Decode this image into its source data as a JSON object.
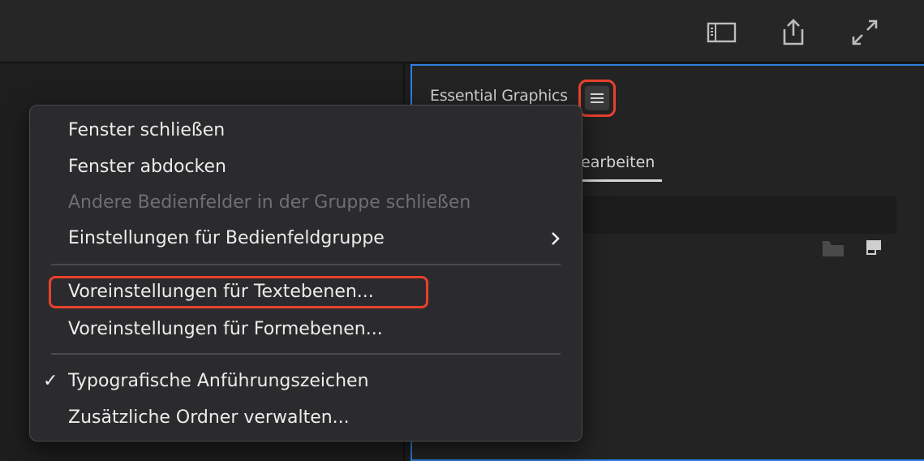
{
  "toolbar": {
    "icons": [
      "panel-layout-icon",
      "share-export-icon",
      "fullscreen-expand-icon"
    ]
  },
  "panel": {
    "title": "Essential Graphics",
    "menu_icon": "hamburger-menu-icon",
    "tab_label": "earbeiten",
    "icons": [
      "folder-icon",
      "new-layer-icon"
    ]
  },
  "context_menu": {
    "items": [
      {
        "label": "Fenster schließen",
        "enabled": true
      },
      {
        "label": "Fenster abdocken",
        "enabled": true
      },
      {
        "label": "Andere Bedienfelder in der Gruppe schließen",
        "enabled": false
      },
      {
        "label": "Einstellungen für Bedienfeldgruppe",
        "enabled": true,
        "submenu": true
      },
      {
        "label": "Voreinstellungen für Textebenen...",
        "enabled": true,
        "highlighted": true
      },
      {
        "label": "Voreinstellungen für Formebenen...",
        "enabled": true
      },
      {
        "label": "Typografische Anführungszeichen",
        "enabled": true,
        "checked": true
      },
      {
        "label": "Zusätzliche Ordner verwalten...",
        "enabled": true
      }
    ],
    "check_glyph": "✓"
  },
  "colors": {
    "accent_blue": "#2f7fe0",
    "highlight_red": "#e8412c"
  }
}
